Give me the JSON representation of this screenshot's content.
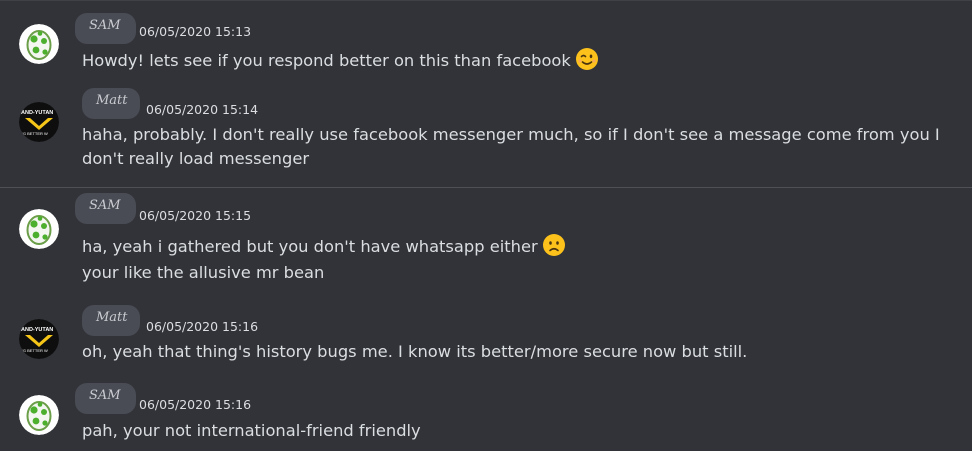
{
  "messages": [
    {
      "author": "SAM",
      "timestamp": "06/05/2020 15:13",
      "lines": [
        "Howdy! lets see if you respond better on this than facebook"
      ],
      "emoji": "winking-face-emoji"
    },
    {
      "author": "Matt",
      "timestamp": "06/05/2020 15:14",
      "lines": [
        "haha, probably. I don't really use facebook messenger much, so if I don't see a message come from you I don't really load messenger"
      ]
    },
    {
      "author": "SAM",
      "timestamp": "06/05/2020 15:15",
      "lines": [
        "ha, yeah i gathered but you don't have whatsapp either",
        "your like the allusive mr bean"
      ],
      "emoji": "sad-face-emoji"
    },
    {
      "author": "Matt",
      "timestamp": "06/05/2020 15:16",
      "lines": [
        "oh, yeah that thing's history bugs me. I know its better/more secure now but still."
      ]
    },
    {
      "author": "SAM",
      "timestamp": "06/05/2020 15:16",
      "lines": [
        "pah, your not international-friend friendly"
      ]
    }
  ],
  "avatars": {
    "sam": {
      "icon": "yoshi-egg-icon"
    },
    "matt": {
      "icon": "weyland-yutani-logo-icon",
      "logo_text_top": "AND-YUTAN",
      "logo_text_bottom": "NG BETTER W"
    }
  },
  "colors": {
    "background": "#313338",
    "text": "#dbdee1",
    "pill": "#4a4c55",
    "divider": "#4e5058"
  }
}
